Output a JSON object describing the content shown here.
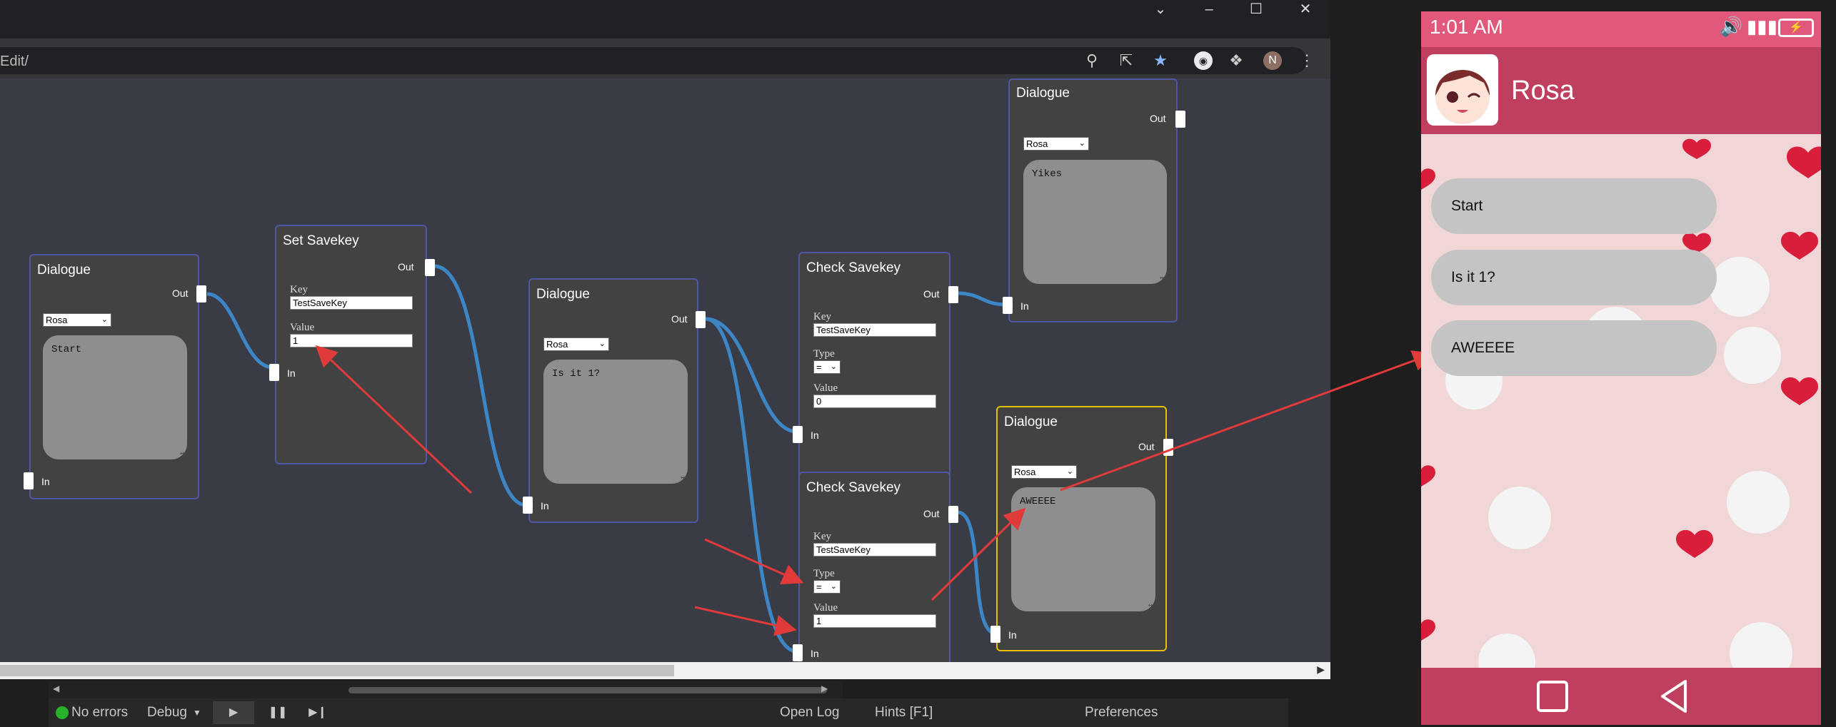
{
  "browser": {
    "url": "Edit/",
    "profile_initial": "N",
    "icons": [
      "zoom-icon",
      "share-icon",
      "bookmark-star-icon",
      "extension-avatar-icon",
      "puzzle-icon",
      "profile-avatar",
      "more-icon"
    ]
  },
  "nodes": [
    {
      "id": "n1",
      "title": "Dialogue",
      "out": "Out",
      "in": "In",
      "speaker": "Rosa",
      "text": "Start"
    },
    {
      "id": "n2",
      "title": "Set Savekey",
      "out": "Out",
      "in": "In",
      "key_label": "Key",
      "key": "TestSaveKey",
      "value_label": "Value",
      "value": "1"
    },
    {
      "id": "n3",
      "title": "Dialogue",
      "out": "Out",
      "in": "In",
      "speaker": "Rosa",
      "text": "Is it 1?"
    },
    {
      "id": "n4",
      "title": "Check Savekey",
      "out": "Out",
      "in": "In",
      "key_label": "Key",
      "key": "TestSaveKey",
      "type_label": "Type",
      "type": "=",
      "value_label": "Value",
      "value": "0"
    },
    {
      "id": "n5",
      "title": "Dialogue",
      "out": "Out",
      "in": "In",
      "speaker": "Rosa",
      "text": "Yikes"
    },
    {
      "id": "n6",
      "title": "Check Savekey",
      "out": "Out",
      "in": "In",
      "key_label": "Key",
      "key": "TestSaveKey",
      "type_label": "Type",
      "type": "=",
      "value_label": "Value",
      "value": "1"
    },
    {
      "id": "n7",
      "title": "Dialogue",
      "out": "Out",
      "in": "In",
      "speaker": "Rosa",
      "text": "AWEEEE"
    }
  ],
  "statusbar": {
    "errors": "No errors",
    "debug": "Debug",
    "open_log": "Open Log",
    "hints": "Hints [F1]",
    "preferences": "Preferences"
  },
  "phone": {
    "time": "1:01 AM",
    "name": "Rosa",
    "messages": [
      "Start",
      "Is it 1?",
      "AWEEEE"
    ]
  },
  "colors": {
    "canvas": "#393b45",
    "node": "#424242",
    "node_border": "#4f57a6",
    "selected_border": "#e5c200",
    "wire": "#3d86c6",
    "arrow": "#e03a3a",
    "phone_status": "#e2587a",
    "phone_header": "#c13f5e"
  }
}
